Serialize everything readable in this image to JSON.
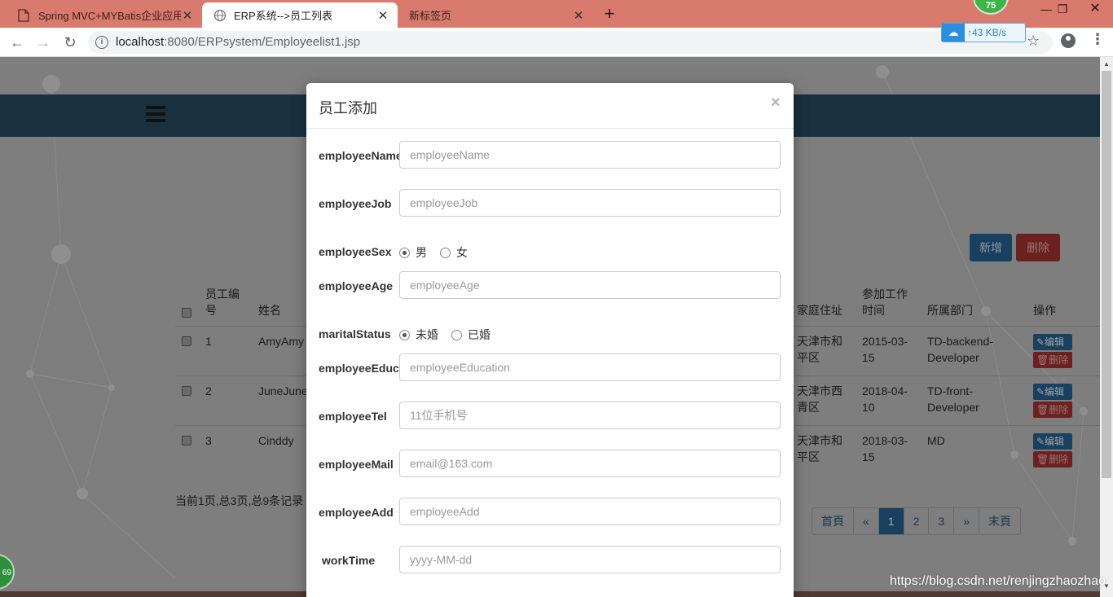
{
  "browser": {
    "tabs": [
      {
        "title": "Spring MVC+MYBatis企业应用",
        "close": "✕"
      },
      {
        "title": "ERP系统-->员工列表",
        "close": "✕"
      },
      {
        "title": "新标签页",
        "close": "✕"
      }
    ],
    "new_tab": "+",
    "badge_top": "75",
    "url_host": "localhost",
    "url_rest": ":8080/ERPsystem/Employeelist1.jsp",
    "speed": "43 KB/s",
    "speed_arrow": "↑"
  },
  "page": {
    "buttons": {
      "add": "新增",
      "delete": "删除"
    },
    "table": {
      "headers": {
        "id": "员工编号",
        "name": "姓名",
        "address": "家庭住址",
        "worktime": "参加工作时间",
        "dept": "所属部门",
        "ops": "操作"
      },
      "rows": [
        {
          "id": "1",
          "name": "AmyAmy",
          "address": "天津市和平区",
          "worktime": "2015-03-15",
          "dept": "TD-backend-Developer"
        },
        {
          "id": "2",
          "name": "JuneJune",
          "address": "天津市西青区",
          "worktime": "2018-04-10",
          "dept": "TD-front-Developer"
        },
        {
          "id": "3",
          "name": "Cinddy",
          "address": "天津市和平区",
          "worktime": "2018-03-15",
          "dept": "MD"
        }
      ],
      "edit_label": "✎编辑",
      "delete_label": "🗑删除"
    },
    "pager_info": "当前1页,总3页,总9条记录",
    "pager": {
      "first": "首頁",
      "prev": "«",
      "p1": "1",
      "p2": "2",
      "p3": "3",
      "next": "»",
      "last": "末頁"
    },
    "badge_left": "69"
  },
  "modal": {
    "title": "员工添加",
    "close": "×",
    "fields": {
      "name": {
        "label": "employeeName",
        "placeholder": "employeeName"
      },
      "job": {
        "label": "employeeJob",
        "placeholder": "employeeJob"
      },
      "sex": {
        "label": "employeeSex",
        "options": [
          "男",
          "女"
        ],
        "selected": "男"
      },
      "age": {
        "label": "employeeAge",
        "placeholder": "employeeAge"
      },
      "marital": {
        "label": "maritalStatus",
        "options": [
          "未婚",
          "已婚"
        ],
        "selected": "未婚"
      },
      "education": {
        "label": "employeeEducation",
        "placeholder": "employeeEducation"
      },
      "tel": {
        "label": "employeeTel",
        "placeholder": "11位手机号"
      },
      "mail": {
        "label": "employeeMail",
        "placeholder": "email@163.com"
      },
      "add": {
        "label": "employeeAdd",
        "placeholder": "employeeAdd"
      },
      "worktime": {
        "label": "workTime",
        "placeholder": "yyyy-MM-dd"
      }
    }
  },
  "watermark": "https://blog.csdn.net/renjingzhaozhao"
}
